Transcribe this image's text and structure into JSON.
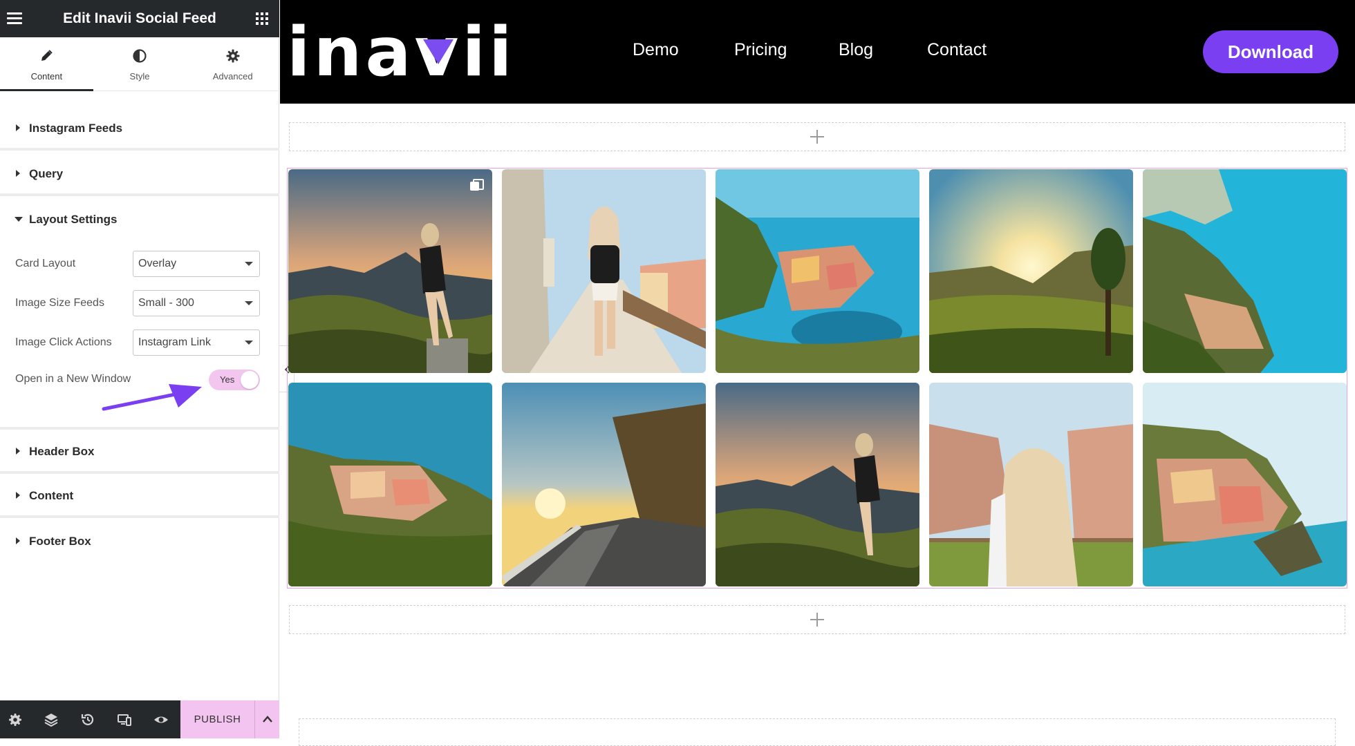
{
  "panel": {
    "title": "Edit Inavii Social Feed",
    "tabs": [
      {
        "label": "Content",
        "icon": "pencil-icon"
      },
      {
        "label": "Style",
        "icon": "half-circle-icon"
      },
      {
        "label": "Advanced",
        "icon": "gear-icon"
      }
    ],
    "active_tab": "Content",
    "sections": {
      "instagram_feeds": "Instagram Feeds",
      "query": "Query",
      "layout_settings": "Layout Settings",
      "header_box": "Header Box",
      "content": "Content",
      "footer_box": "Footer Box"
    },
    "layout": {
      "card_layout": {
        "label": "Card Layout",
        "value": "Overlay"
      },
      "image_size": {
        "label": "Image Size Feeds",
        "value": "Small - 300"
      },
      "click_actions": {
        "label": "Image Click Actions",
        "value": "Instagram Link"
      },
      "new_window": {
        "label": "Open in a New Window",
        "value": "Yes",
        "on": true
      }
    },
    "bottom_bar": {
      "icons": [
        "settings-icon",
        "layers-icon",
        "history-icon",
        "responsive-icon",
        "preview-eye-icon"
      ],
      "publish_label": "PUBLISH"
    }
  },
  "site": {
    "logo_pre": "ina",
    "logo_post": "ii",
    "nav": [
      "Demo",
      "Pricing",
      "Blog",
      "Contact"
    ],
    "download_label": "Download"
  },
  "colors": {
    "brand_purple": "#7b3ff2",
    "publish_pink": "#f2c4ef",
    "editor_dark": "#26292c"
  },
  "gallery": {
    "columns": 5,
    "rows": 2,
    "photos": [
      {
        "scene": "woman-on-cliff-at-sunset",
        "multi": true
      },
      {
        "scene": "woman-walking-village-path",
        "multi": false
      },
      {
        "scene": "vernazza-harbor",
        "multi": false
      },
      {
        "scene": "sunset-over-hills",
        "multi": false
      },
      {
        "scene": "turquoise-coast-cliffs",
        "multi": false
      },
      {
        "scene": "corniglia-village-on-hill",
        "multi": false
      },
      {
        "scene": "coastal-road-sunrise",
        "multi": false
      },
      {
        "scene": "woman-on-cliff-at-sunset-2",
        "multi": false
      },
      {
        "scene": "blonde-woman-viewing-village",
        "multi": false
      },
      {
        "scene": "manarola-cliff-village",
        "multi": false
      }
    ]
  }
}
